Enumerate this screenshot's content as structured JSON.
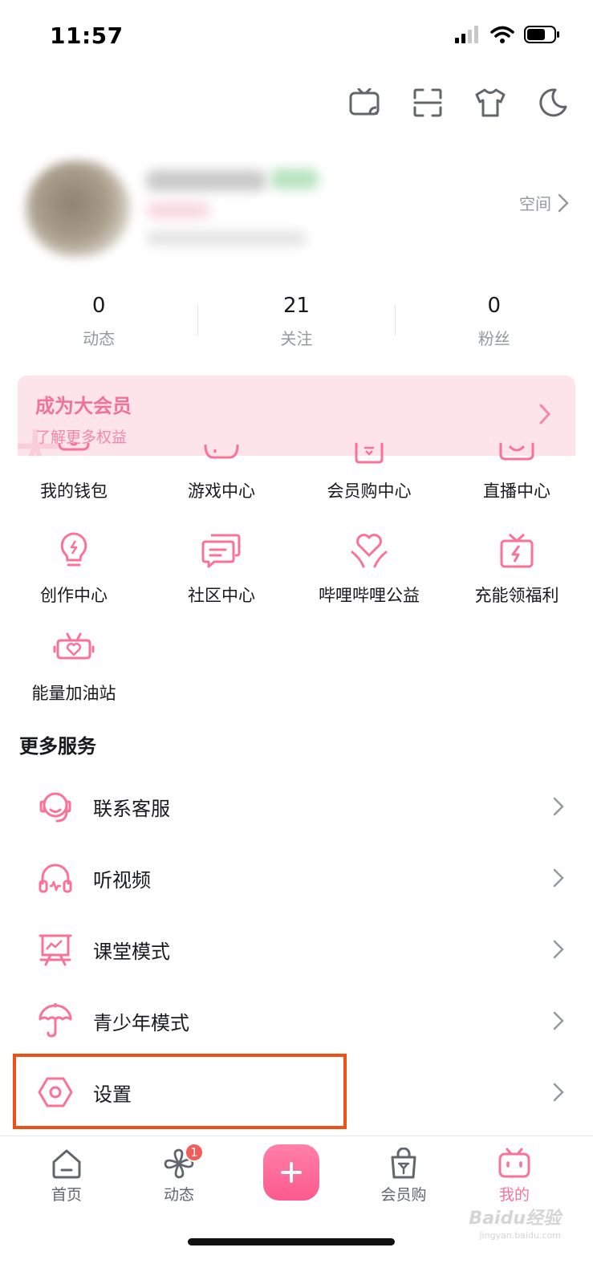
{
  "status_bar": {
    "time": "11:57"
  },
  "profile": {
    "space_label": "空间"
  },
  "stats": [
    {
      "value": "0",
      "label": "动态"
    },
    {
      "value": "21",
      "label": "关注"
    },
    {
      "value": "0",
      "label": "粉丝"
    }
  ],
  "vip_banner": {
    "title": "成为大会员",
    "subtitle": "了解更多权益",
    "deco": "大"
  },
  "services": [
    {
      "label": "我的钱包",
      "icon": "wallet-icon"
    },
    {
      "label": "游戏中心",
      "icon": "gamepad-icon"
    },
    {
      "label": "会员购中心",
      "icon": "shopping-bag-icon"
    },
    {
      "label": "直播中心",
      "icon": "live-icon"
    },
    {
      "label": "创作中心",
      "icon": "lightbulb-icon"
    },
    {
      "label": "社区中心",
      "icon": "chat-icon"
    },
    {
      "label": "哔哩哔哩公益",
      "icon": "heart-hands-icon"
    },
    {
      "label": "充能领福利",
      "icon": "gift-bolt-icon"
    },
    {
      "label": "能量加油站",
      "icon": "energy-station-icon"
    }
  ],
  "more_services": {
    "title": "更多服务",
    "items": [
      {
        "label": "联系客服",
        "icon": "headset-icon"
      },
      {
        "label": "听视频",
        "icon": "headphones-icon"
      },
      {
        "label": "课堂模式",
        "icon": "classroom-icon"
      },
      {
        "label": "青少年模式",
        "icon": "umbrella-icon"
      },
      {
        "label": "设置",
        "icon": "settings-icon"
      }
    ]
  },
  "bottom_nav": {
    "items": [
      {
        "label": "首页",
        "icon": "home-icon"
      },
      {
        "label": "动态",
        "icon": "pinwheel-icon",
        "badge": "1"
      },
      {
        "label": "会员购",
        "icon": "shopping-bag-icon"
      },
      {
        "label": "我的",
        "icon": "tv-face-icon",
        "active": true
      }
    ],
    "publish_icon": "plus-icon"
  },
  "watermark": {
    "text": "Baidu经验",
    "sub": "jingyan.baidu.com"
  },
  "colors": {
    "accent": "#fb7299",
    "highlight": "#f04f17",
    "vip_bg": "#fde3ea",
    "text_secondary": "#9499a0"
  }
}
